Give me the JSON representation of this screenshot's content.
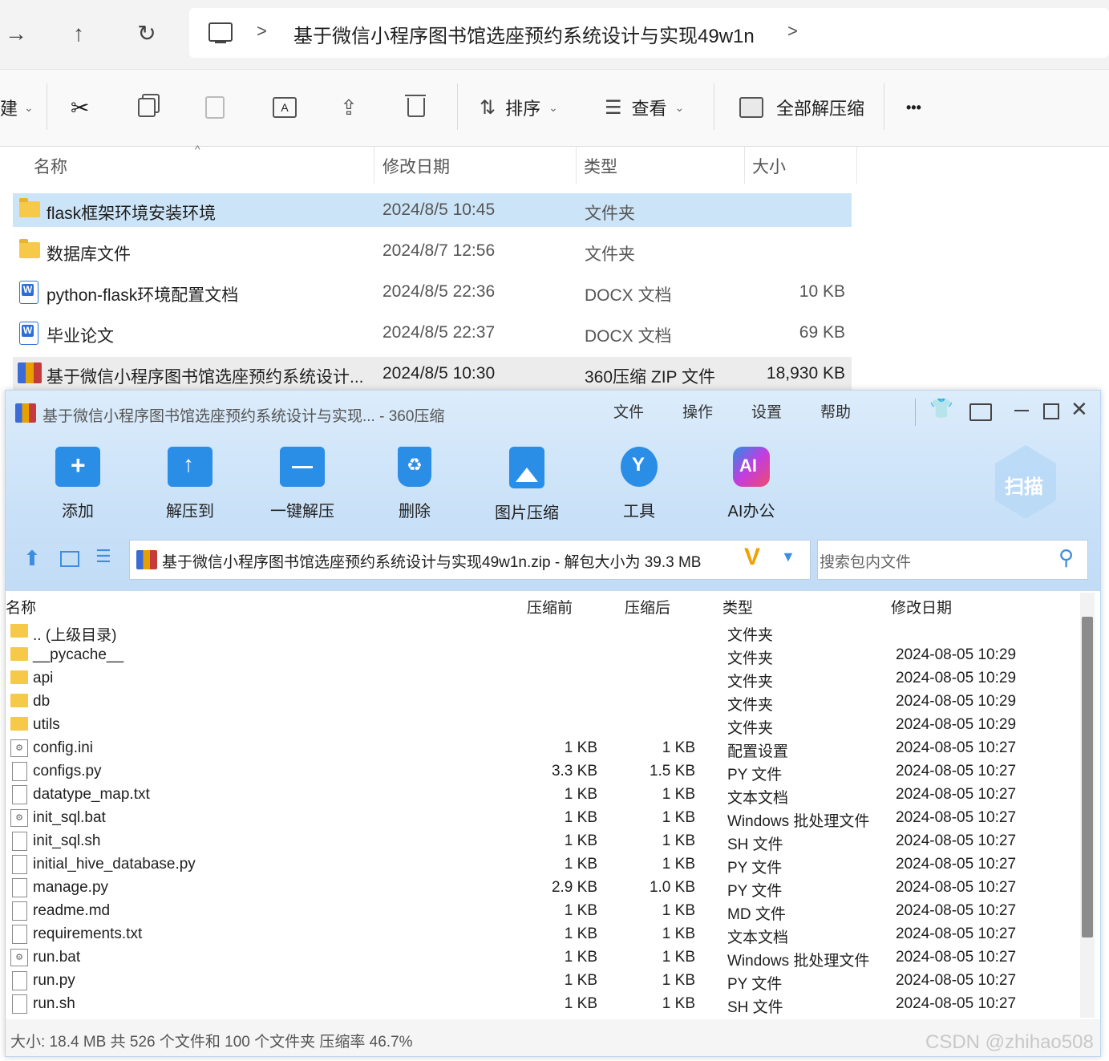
{
  "explorer": {
    "nav": {
      "back": "→",
      "up": "↑",
      "refresh": "↻",
      "chevron": "›"
    },
    "breadcrumb": {
      "sep": ">",
      "current": "基于微信小程序图书馆选座预约系统设计与实现49w1n",
      "next": ">"
    },
    "toolbar": {
      "new_suffix": "建",
      "sort": "排序",
      "view": "查看",
      "extract_all": "全部解压缩",
      "more": "•••"
    },
    "columns": {
      "name": "名称",
      "modified": "修改日期",
      "type": "类型",
      "size": "大小"
    },
    "rows": [
      {
        "name": "flask框架环境安装环境",
        "modified": "2024/8/5 10:45",
        "type": "文件夹",
        "size": "",
        "icon": "folder-icon"
      },
      {
        "name": "数据库文件",
        "modified": "2024/8/7 12:56",
        "type": "文件夹",
        "size": "",
        "icon": "folder-icon"
      },
      {
        "name": "python-flask环境配置文档",
        "modified": "2024/8/5 22:36",
        "type": "DOCX 文档",
        "size": "10 KB",
        "icon": "word-doc-icon"
      },
      {
        "name": "毕业论文",
        "modified": "2024/8/5 22:37",
        "type": "DOCX 文档",
        "size": "69 KB",
        "icon": "word-doc-icon"
      },
      {
        "name": "基于微信小程序图书馆选座预约系统设计...",
        "modified": "2024/8/5 10:30",
        "type": "360压缩 ZIP 文件",
        "size": "18,930 KB",
        "icon": "zip-archive-icon"
      }
    ]
  },
  "zip": {
    "title": "基于微信小程序图书馆选座预约系统设计与实现... - 360压缩",
    "menu": [
      "文件",
      "操作",
      "设置",
      "帮助"
    ],
    "tools": [
      {
        "label": "添加",
        "color": "#2a8de6"
      },
      {
        "label": "解压到",
        "color": "#2a8de6"
      },
      {
        "label": "一键解压",
        "color": "#2a8de6"
      },
      {
        "label": "删除",
        "color": "#2a8de6"
      },
      {
        "label": "图片压缩",
        "color": "#2a8de6"
      },
      {
        "label": "工具",
        "color": "#2a8de6"
      },
      {
        "label": "AI办公",
        "color": "#c23de0"
      }
    ],
    "scan": "扫描",
    "path": "基于微信小程序图书馆选座预约系统设计与实现49w1n.zip - 解包大小为 39.3 MB",
    "search_placeholder": "搜索包内文件",
    "columns": {
      "name": "名称",
      "before": "压缩前",
      "after": "压缩后",
      "type": "类型",
      "modified": "修改日期"
    },
    "rows": [
      {
        "name": ".. (上级目录)",
        "before": "",
        "after": "",
        "type": "文件夹",
        "modified": "",
        "icon": "folder"
      },
      {
        "name": "__pycache__",
        "before": "",
        "after": "",
        "type": "文件夹",
        "modified": "2024-08-05 10:29",
        "icon": "folder"
      },
      {
        "name": "api",
        "before": "",
        "after": "",
        "type": "文件夹",
        "modified": "2024-08-05 10:29",
        "icon": "folder"
      },
      {
        "name": "db",
        "before": "",
        "after": "",
        "type": "文件夹",
        "modified": "2024-08-05 10:29",
        "icon": "folder"
      },
      {
        "name": "utils",
        "before": "",
        "after": "",
        "type": "文件夹",
        "modified": "2024-08-05 10:29",
        "icon": "folder"
      },
      {
        "name": "config.ini",
        "before": "1 KB",
        "after": "1 KB",
        "type": "配置设置",
        "modified": "2024-08-05 10:27",
        "icon": "gear"
      },
      {
        "name": "configs.py",
        "before": "3.3 KB",
        "after": "1.5 KB",
        "type": "PY 文件",
        "modified": "2024-08-05 10:27",
        "icon": "page"
      },
      {
        "name": "datatype_map.txt",
        "before": "1 KB",
        "after": "1 KB",
        "type": "文本文档",
        "modified": "2024-08-05 10:27",
        "icon": "page"
      },
      {
        "name": "init_sql.bat",
        "before": "1 KB",
        "after": "1 KB",
        "type": "Windows 批处理文件",
        "modified": "2024-08-05 10:27",
        "icon": "gear"
      },
      {
        "name": "init_sql.sh",
        "before": "1 KB",
        "after": "1 KB",
        "type": "SH 文件",
        "modified": "2024-08-05 10:27",
        "icon": "page"
      },
      {
        "name": "initial_hive_database.py",
        "before": "1 KB",
        "after": "1 KB",
        "type": "PY 文件",
        "modified": "2024-08-05 10:27",
        "icon": "page"
      },
      {
        "name": "manage.py",
        "before": "2.9 KB",
        "after": "1.0 KB",
        "type": "PY 文件",
        "modified": "2024-08-05 10:27",
        "icon": "page"
      },
      {
        "name": "readme.md",
        "before": "1 KB",
        "after": "1 KB",
        "type": "MD 文件",
        "modified": "2024-08-05 10:27",
        "icon": "page"
      },
      {
        "name": "requirements.txt",
        "before": "1 KB",
        "after": "1 KB",
        "type": "文本文档",
        "modified": "2024-08-05 10:27",
        "icon": "page"
      },
      {
        "name": "run.bat",
        "before": "1 KB",
        "after": "1 KB",
        "type": "Windows 批处理文件",
        "modified": "2024-08-05 10:27",
        "icon": "gear"
      },
      {
        "name": "run.py",
        "before": "1 KB",
        "after": "1 KB",
        "type": "PY 文件",
        "modified": "2024-08-05 10:27",
        "icon": "page"
      },
      {
        "name": "run.sh",
        "before": "1 KB",
        "after": "1 KB",
        "type": "SH 文件",
        "modified": "2024-08-05 10:27",
        "icon": "page"
      }
    ],
    "status": "大小: 18.4 MB 共 526 个文件和 100 个文件夹 压缩率 46.7%"
  },
  "watermark": "CSDN @zhihao508"
}
